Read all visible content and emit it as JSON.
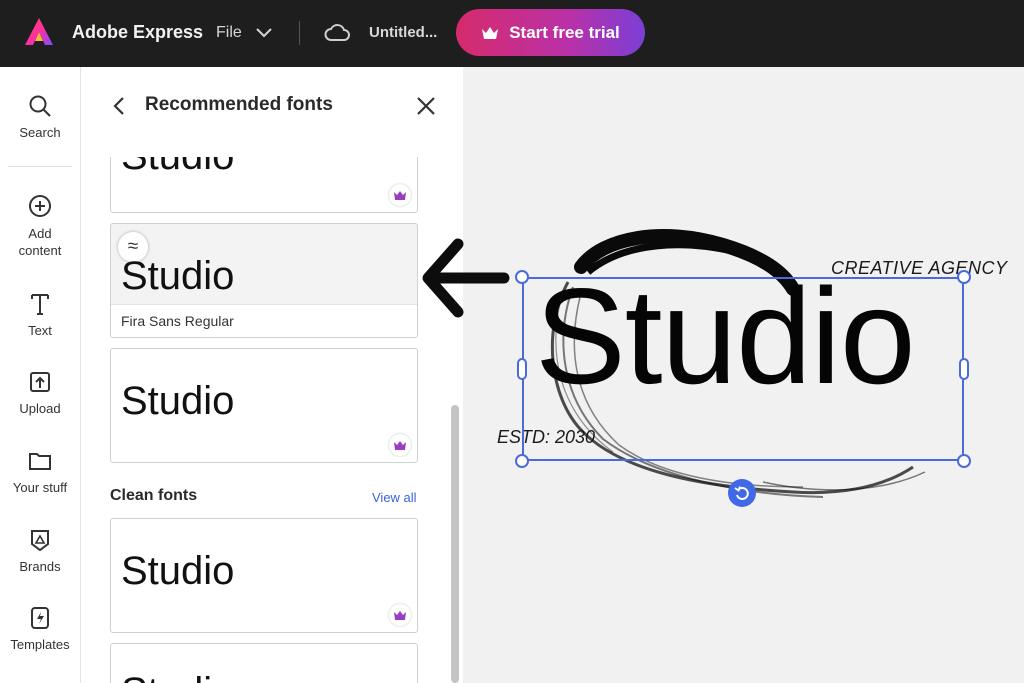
{
  "topbar": {
    "app_name": "Adobe Express",
    "file_label": "File",
    "document_title": "Untitled...",
    "trial_button": "Start free trial"
  },
  "rail": {
    "items": [
      {
        "label": "Search",
        "icon": "search-icon"
      },
      {
        "label": "Add content",
        "icon": "plus-circle-icon"
      },
      {
        "label": "Text",
        "icon": "text-icon"
      },
      {
        "label": "Upload",
        "icon": "upload-icon"
      },
      {
        "label": "Your stuff",
        "icon": "folder-icon"
      },
      {
        "label": "Brands",
        "icon": "brand-icon"
      },
      {
        "label": "Templates",
        "icon": "templates-icon"
      }
    ]
  },
  "panel": {
    "title": "Recommended fonts",
    "cards": [
      {
        "sample": "Studio",
        "premium": true
      },
      {
        "sample": "Studio",
        "font_name": "Fira Sans Regular",
        "premium": false,
        "similar_icon": "≈"
      },
      {
        "sample": "Studio",
        "premium": true
      }
    ],
    "section": {
      "title": "Clean fonts",
      "view_all": "View all",
      "cards": [
        {
          "sample": "Studio",
          "premium": true
        },
        {
          "sample": "Studio",
          "premium": false
        }
      ]
    }
  },
  "canvas": {
    "tagline": "CREATIVE AGENCY",
    "headline": "Studio",
    "established": "ESTD: 2030"
  },
  "colors": {
    "topbar": "#1e1e1e",
    "accent": "#4b6bd8",
    "trial_gradient_start": "#d62b6b",
    "trial_gradient_end": "#7a3fd6",
    "premium_crown": "#9a3fc4"
  }
}
